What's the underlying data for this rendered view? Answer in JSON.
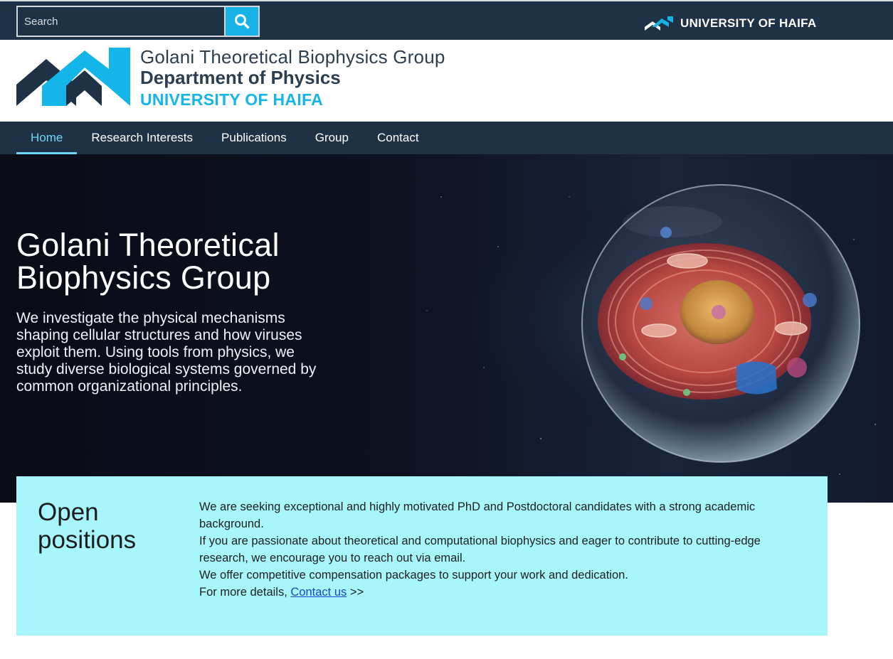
{
  "search": {
    "placeholder": "Search",
    "button_icon": "search-icon"
  },
  "brand_top": {
    "text": "UNIVERSITY OF HAIFA",
    "icon": "university-logo-icon"
  },
  "logo": {
    "line1": "Golani Theoretical Biophysics Group",
    "line2": "Department of Physics",
    "line3": "UNIVERSITY OF HAIFA"
  },
  "nav": {
    "items": [
      {
        "label": "Home",
        "active": true
      },
      {
        "label": "Research Interests",
        "active": false
      },
      {
        "label": "Publications",
        "active": false
      },
      {
        "label": "Group",
        "active": false
      },
      {
        "label": "Contact",
        "active": false
      }
    ]
  },
  "hero": {
    "title": "Golani Theoretical Biophysics Group",
    "description": "We investigate the physical mechanisms shaping cellular structures and how viruses exploit them. Using tools from physics, we study diverse biological systems governed by common organizational principles."
  },
  "positions": {
    "title": "Open positions",
    "para1": "We are seeking exceptional and highly motivated PhD and Postdoctoral candidates with a strong academic background.",
    "para2": "If you are passionate about theoretical and computational biophysics and eager to contribute to cutting-edge research, we encourage you to reach out via email.",
    "para3": "We offer competitive compensation packages to support your work and dedication.",
    "para4_prefix": "For more details, ",
    "link_label": "Contact us",
    "para4_suffix": " >>"
  },
  "colors": {
    "dark_navy": "#1f3144",
    "accent_cyan": "#17b2e6",
    "nav_active": "#6fd6f7",
    "positions_bg": "#a6f6fb"
  }
}
